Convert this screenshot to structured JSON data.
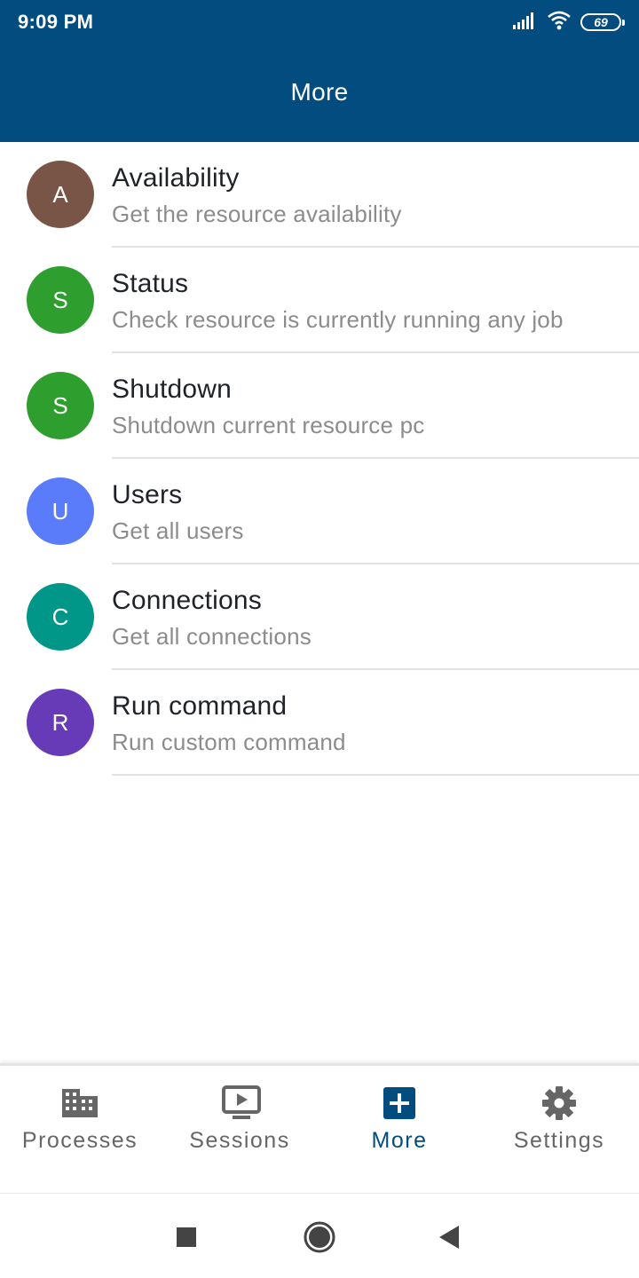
{
  "status_bar": {
    "time": "9:09 PM",
    "battery": "69",
    "icons": [
      "signal-icon",
      "wifi-icon",
      "battery-icon"
    ]
  },
  "appbar": {
    "title": "More"
  },
  "items": [
    {
      "letter": "A",
      "title": "Availability",
      "subtitle": "Get the resource availability",
      "color": "#795548"
    },
    {
      "letter": "S",
      "title": "Status",
      "subtitle": "Check resource is currently running any job",
      "color": "#2e9e2e"
    },
    {
      "letter": "S",
      "title": "Shutdown",
      "subtitle": "Shutdown current resource pc",
      "color": "#2e9e2e"
    },
    {
      "letter": "U",
      "title": "Users",
      "subtitle": "Get all users",
      "color": "#5b7cfa"
    },
    {
      "letter": "C",
      "title": "Connections",
      "subtitle": "Get all connections",
      "color": "#009688"
    },
    {
      "letter": "R",
      "title": "Run command",
      "subtitle": "Run custom command",
      "color": "#673ab7"
    }
  ],
  "bottom_nav": [
    {
      "label": "Processes",
      "icon": "building-icon",
      "active": false
    },
    {
      "label": "Sessions",
      "icon": "play-screen-icon",
      "active": false
    },
    {
      "label": "More",
      "icon": "plus-box-icon",
      "active": true
    },
    {
      "label": "Settings",
      "icon": "gear-icon",
      "active": false
    }
  ],
  "system_nav": [
    "recents-square-icon",
    "home-circle-icon",
    "back-triangle-icon"
  ],
  "colors": {
    "primary": "#034c80",
    "nav_inactive": "#666666",
    "subtitle": "#8c8c8c"
  }
}
